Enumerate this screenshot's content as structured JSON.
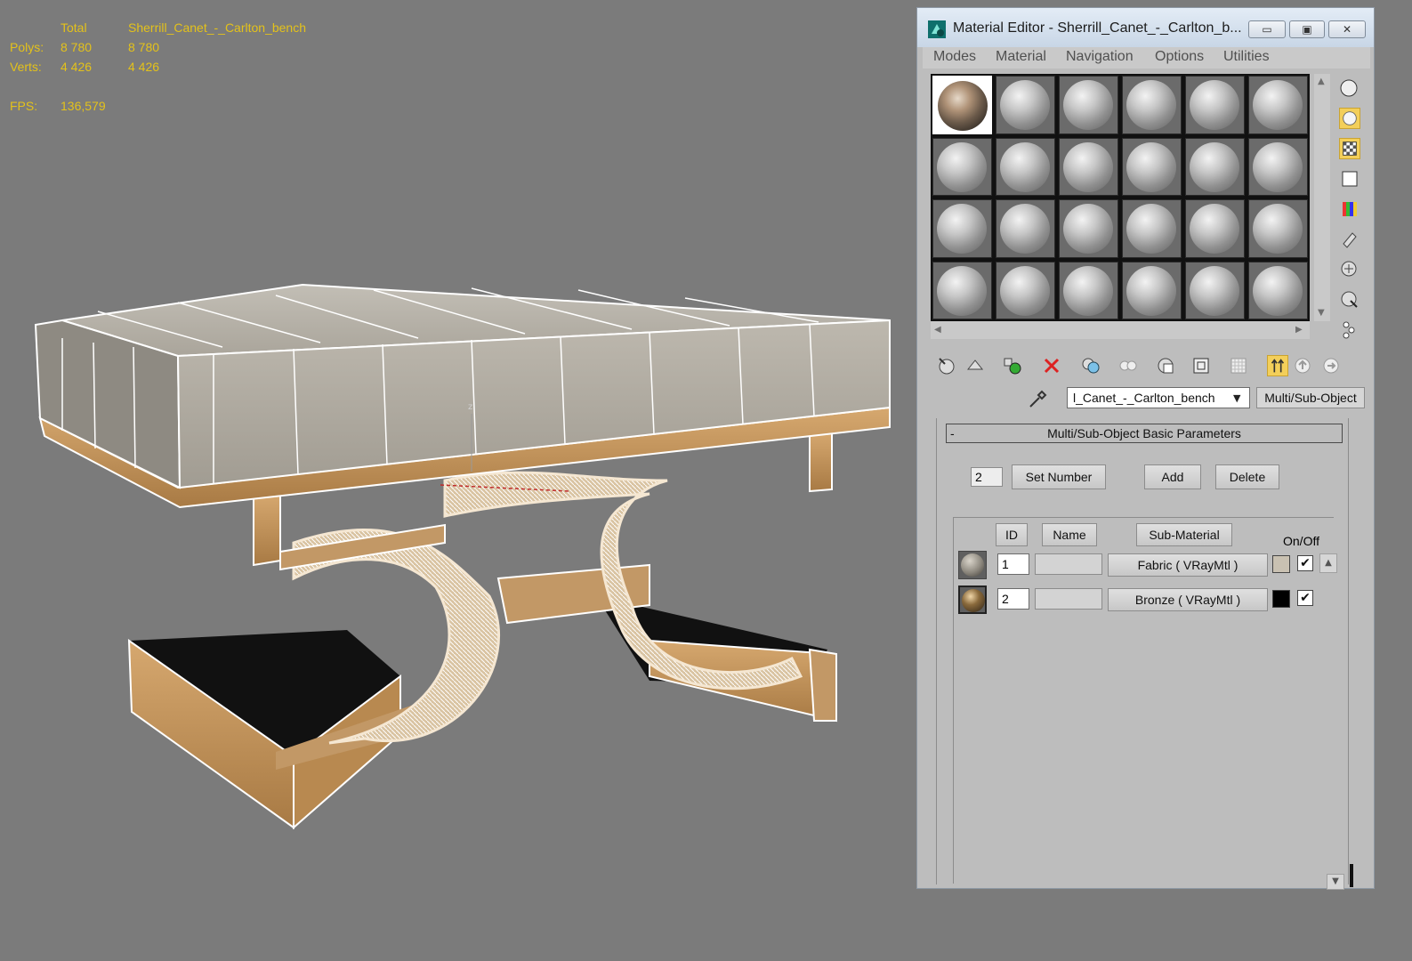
{
  "viewport": {
    "stats": {
      "header": {
        "col1": "Total",
        "col2": "Sherrill_Canet_-_Carlton_bench"
      },
      "polys": {
        "label": "Polys:",
        "total": "8 780",
        "object": "8 780"
      },
      "verts": {
        "label": "Verts:",
        "total": "4 426",
        "object": "4 426"
      },
      "fps": {
        "label": "FPS:",
        "value": "136,579"
      }
    },
    "model": {
      "gizmo_label": "z",
      "fabric_color": "#a8a49c",
      "wire_color": "#ffffff",
      "bronze_color": "#c99a63"
    }
  },
  "material_editor": {
    "title": "Material Editor - Sherrill_Canet_-_Carlton_b...",
    "window_buttons": {
      "minimize": "▭",
      "maximize": "▣",
      "close": "✕"
    },
    "menu": [
      "Modes",
      "Material",
      "Navigation",
      "Options",
      "Utilities"
    ],
    "slots": {
      "rows": 4,
      "cols": 6,
      "active_index": 0
    },
    "material_name": "l_Canet_-_Carlton_bench",
    "material_type": "Multi/Sub-Object",
    "rollout": {
      "collapse": "-",
      "title": "Multi/Sub-Object Basic Parameters",
      "set_number_value": "2",
      "set_number_label": "Set Number",
      "add_label": "Add",
      "delete_label": "Delete",
      "headers": {
        "id": "ID",
        "name": "Name",
        "sub_material": "Sub-Material",
        "on_off": "On/Off"
      },
      "rows": [
        {
          "id": "1",
          "name": "",
          "sub_material": "Fabric  ( VRayMtl )",
          "color": "#c9c1b2",
          "on": "✔"
        },
        {
          "id": "2",
          "name": "",
          "sub_material": "Bronze  ( VRayMtl )",
          "color": "#000000",
          "on": "✔"
        }
      ]
    },
    "accent": "#f3cf5a"
  }
}
